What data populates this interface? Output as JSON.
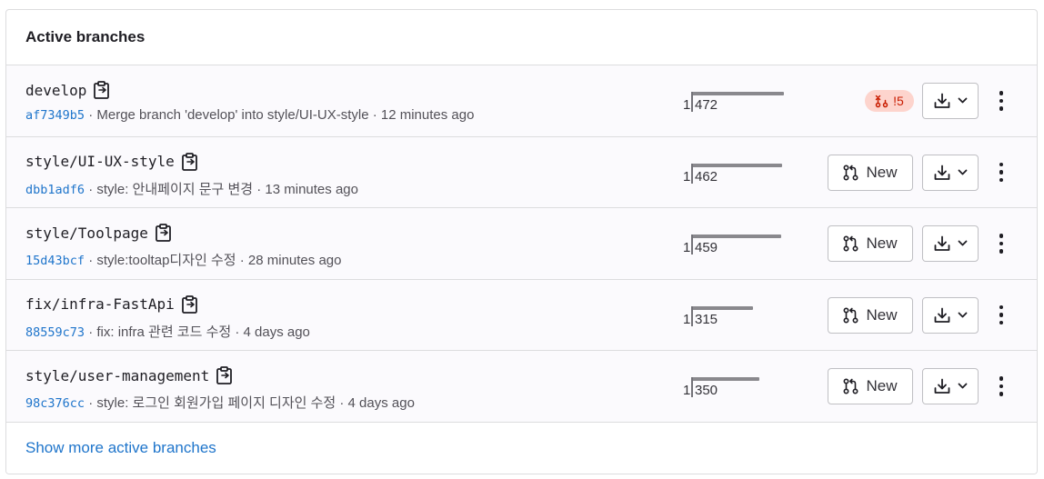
{
  "panel": {
    "title": "Active branches",
    "footer_link": "Show more active branches"
  },
  "colors": {
    "link": "#1f75cb",
    "mr_badge_bg": "#fdd4cd",
    "mr_badge_fg": "#c91c00",
    "border": "#dcdcde"
  },
  "icons": {
    "copy": "clipboard-icon",
    "merge_request": "merge-request-icon",
    "merge_request_closed": "merge-request-closed-icon",
    "download": "download-icon",
    "chevron": "chevron-down-icon",
    "more": "kebab-menu-icon"
  },
  "branches": [
    {
      "name": "develop",
      "sha": "af7349b5",
      "message": " · Merge branch 'develop' into style/UI-UX-style · 12 minutes ago",
      "behind": "1",
      "ahead": "472",
      "ahead_bar_fraction": 1.0,
      "mr_badge": "!5",
      "new_label": ""
    },
    {
      "name": "style/UI-UX-style",
      "sha": "dbb1adf6",
      "message": " · style: 안내페이지 문구 변경 · 13 minutes ago",
      "behind": "1",
      "ahead": "462",
      "ahead_bar_fraction": 0.98,
      "mr_badge": "",
      "new_label": "New"
    },
    {
      "name": "style/Toolpage",
      "sha": "15d43bcf",
      "message": " · style:tooltap디자인 수정 · 28 minutes ago",
      "behind": "1",
      "ahead": "459",
      "ahead_bar_fraction": 0.97,
      "mr_badge": "",
      "new_label": "New"
    },
    {
      "name": "fix/infra-FastApi",
      "sha": "88559c73",
      "message": " · fix: infra 관련 코드 수정 · 4 days ago",
      "behind": "1",
      "ahead": "315",
      "ahead_bar_fraction": 0.67,
      "mr_badge": "",
      "new_label": "New"
    },
    {
      "name": "style/user-management",
      "sha": "98c376cc",
      "message": " · style: 로그인 회원가입 페이지 디자인 수정 · 4 days ago",
      "behind": "1",
      "ahead": "350",
      "ahead_bar_fraction": 0.74,
      "mr_badge": "",
      "new_label": "New"
    }
  ]
}
